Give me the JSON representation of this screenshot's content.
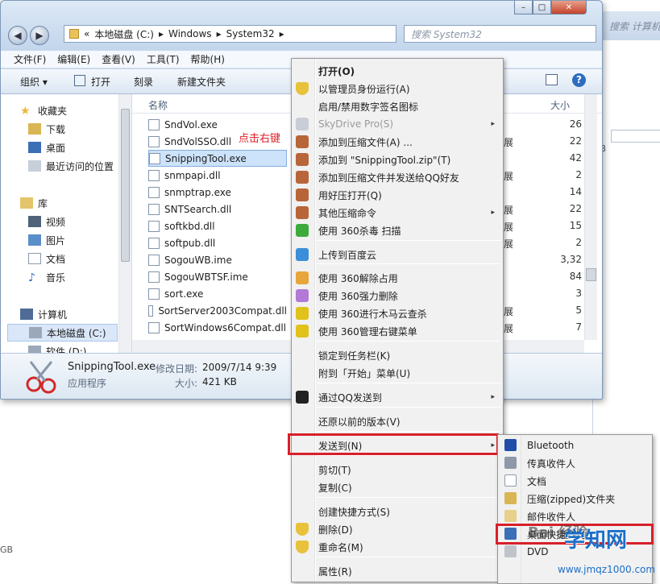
{
  "background_window": {
    "search_placeholder": "搜索 计算机",
    "size_text": "GB",
    "bottom_text": "GB"
  },
  "window": {
    "controls": {
      "minimize": "–",
      "maximize": "□",
      "close": "✕"
    },
    "breadcrumb": [
      "«",
      "本地磁盘 (C:)",
      "▸",
      "Windows",
      "▸",
      "System32",
      "▸"
    ],
    "search_placeholder": "搜索 System32",
    "menu": [
      "文件(F)",
      "编辑(E)",
      "查看(V)",
      "工具(T)",
      "帮助(H)"
    ],
    "toolbar": {
      "organize": "组织 ▾",
      "open": "打开",
      "burn": "刻录",
      "new_folder": "新建文件夹"
    },
    "nav": {
      "favorites": "收藏夹",
      "downloads": "下载",
      "desktop": "桌面",
      "recent": "最近访问的位置",
      "libraries": "库",
      "videos": "视频",
      "pictures": "图片",
      "documents": "文档",
      "music": "音乐",
      "computer": "计算机",
      "local_disk": "本地磁盘 (C:)",
      "software": "软件 (D:)"
    },
    "columns": {
      "name": "名称",
      "size": "大小"
    },
    "files": [
      {
        "name": "SndVol.exe",
        "type": "",
        "size": "26"
      },
      {
        "name": "SndVolSSO.dll",
        "type": "展",
        "size": "22"
      },
      {
        "name": "SnippingTool.exe",
        "type": "",
        "size": "42"
      },
      {
        "name": "snmpapi.dll",
        "type": "展",
        "size": "2"
      },
      {
        "name": "snmptrap.exe",
        "type": "",
        "size": "14"
      },
      {
        "name": "SNTSearch.dll",
        "type": "展",
        "size": "22"
      },
      {
        "name": "softkbd.dll",
        "type": "展",
        "size": "15"
      },
      {
        "name": "softpub.dll",
        "type": "展",
        "size": "2"
      },
      {
        "name": "SogouWB.ime",
        "type": "",
        "size": "3,32"
      },
      {
        "name": "SogouWBTSF.ime",
        "type": "",
        "size": "84"
      },
      {
        "name": "sort.exe",
        "type": "",
        "size": "3"
      },
      {
        "name": "SortServer2003Compat.dll",
        "type": "展",
        "size": "5"
      },
      {
        "name": "SortWindows6Compat.dll",
        "type": "展",
        "size": "7"
      }
    ],
    "annotation": "点击右键",
    "details": {
      "filename": "SnippingTool.exe",
      "modified_label": "修改日期:",
      "modified": "2009/7/14 9:39",
      "type": "应用程序",
      "size_label": "大小:",
      "size": "421 KB"
    }
  },
  "context_menu": [
    {
      "label": "打开(O)",
      "bold": true
    },
    {
      "label": "以管理员身份运行(A)",
      "icon": "shield-icon"
    },
    {
      "label": "启用/禁用数字签名图标"
    },
    {
      "label": "SkyDrive Pro(S)",
      "disabled": true,
      "submenu": "▸",
      "icon": "cloud-icon"
    },
    {
      "label": "添加到压缩文件(A) ...",
      "icon": "archive-icon"
    },
    {
      "label": "添加到 \"SnippingTool.zip\"(T)",
      "icon": "archive-icon"
    },
    {
      "label": "添加到压缩文件并发送给QQ好友",
      "icon": "archive-icon"
    },
    {
      "label": "用好压打开(Q)",
      "icon": "archive-icon"
    },
    {
      "label": "其他压缩命令",
      "submenu": "▸",
      "icon": "archive-icon"
    },
    {
      "label": "使用 360杀毒 扫描",
      "icon": "antivirus-icon"
    },
    {
      "label": "上传到百度云",
      "icon": "baidu-cloud-icon"
    },
    {
      "label": "使用 360解除占用",
      "icon": "unlock-icon"
    },
    {
      "label": "使用 360强力删除",
      "icon": "shred-icon"
    },
    {
      "label": "使用 360进行木马云查杀",
      "icon": "trojan-scan-icon"
    },
    {
      "label": "使用 360管理右键菜单",
      "icon": "manage-menu-icon"
    },
    {
      "label": "锁定到任务栏(K)"
    },
    {
      "label": "附到「开始」菜单(U)"
    },
    {
      "label": "通过QQ发送到",
      "submenu": "▸",
      "icon": "qq-icon"
    },
    {
      "label": "还原以前的版本(V)"
    },
    {
      "label": "发送到(N)",
      "submenu": "▸"
    },
    {
      "label": "剪切(T)"
    },
    {
      "label": "复制(C)"
    },
    {
      "label": "创建快捷方式(S)"
    },
    {
      "label": "删除(D)",
      "icon": "shield-icon"
    },
    {
      "label": "重命名(M)",
      "icon": "shield-icon"
    },
    {
      "label": "属性(R)"
    }
  ],
  "send_to_menu": [
    {
      "label": "Bluetooth",
      "icon": "bluetooth-icon"
    },
    {
      "label": "传真收件人",
      "icon": "fax-icon"
    },
    {
      "label": "文档",
      "icon": "document-icon"
    },
    {
      "label": "压缩(zipped)文件夹",
      "icon": "zip-folder-icon"
    },
    {
      "label": "邮件收件人",
      "icon": "mail-icon"
    },
    {
      "label": "桌面快捷方式",
      "icon": "desktop-icon"
    },
    {
      "label": "DVD",
      "icon": "dvd-icon"
    }
  ],
  "watermark": {
    "text": "Bai 经验",
    "logo": "学知网",
    "url": "www.jmqz1000.com"
  },
  "colors": {
    "highlight_box": "#d7202b",
    "selection": "#cde3fb",
    "annotation": "#e0202a"
  }
}
